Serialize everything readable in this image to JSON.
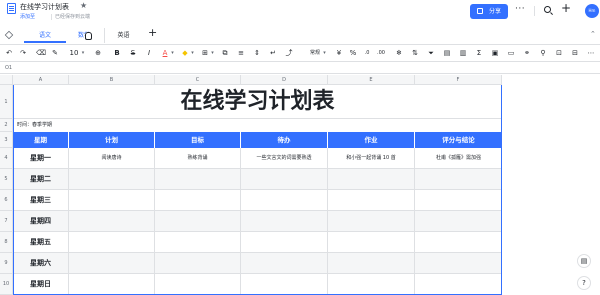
{
  "header": {
    "doc_title": "在线学习计划表",
    "star_icon": "star-icon",
    "add_space": "添加至",
    "saved_status": "已经保存到云端",
    "share_label": "分享",
    "more_label": "···",
    "avatar_text": "Hm"
  },
  "tabs": [
    {
      "label": "语文"
    },
    {
      "label": "数学"
    },
    {
      "label": "英语"
    }
  ],
  "toolbar": {
    "font_size": "10",
    "number_format": "常规"
  },
  "formula": {
    "cell_ref": "O1"
  },
  "columns": [
    "A",
    "B",
    "C",
    "D",
    "E",
    "F"
  ],
  "rows": [
    "1",
    "2",
    "3",
    "4",
    "5",
    "6",
    "7",
    "8",
    "9",
    "10",
    "11"
  ],
  "sheet": {
    "title": "在线学习计划表",
    "time_label": "时间：春季学期",
    "headers": [
      "星期",
      "计划",
      "目标",
      "待办",
      "作业",
      "评分与结论"
    ],
    "data": [
      [
        "星期一",
        "阅读唐诗",
        "熟练背诵",
        "一些文言文的词需要熟透",
        "和小强一起背诵 10 首",
        "杜甫《孤雁》需加强"
      ],
      [
        "星期二",
        "",
        "",
        "",
        "",
        ""
      ],
      [
        "星期三",
        "",
        "",
        "",
        "",
        ""
      ],
      [
        "星期四",
        "",
        "",
        "",
        "",
        ""
      ],
      [
        "星期五",
        "",
        "",
        "",
        "",
        ""
      ],
      [
        "星期六",
        "",
        "",
        "",
        "",
        ""
      ],
      [
        "星期日",
        "",
        "",
        "",
        "",
        ""
      ]
    ]
  },
  "colors": {
    "accent": "#3370ff",
    "header_fill": "#3370ff",
    "alt_row": "#f5f6f7"
  }
}
